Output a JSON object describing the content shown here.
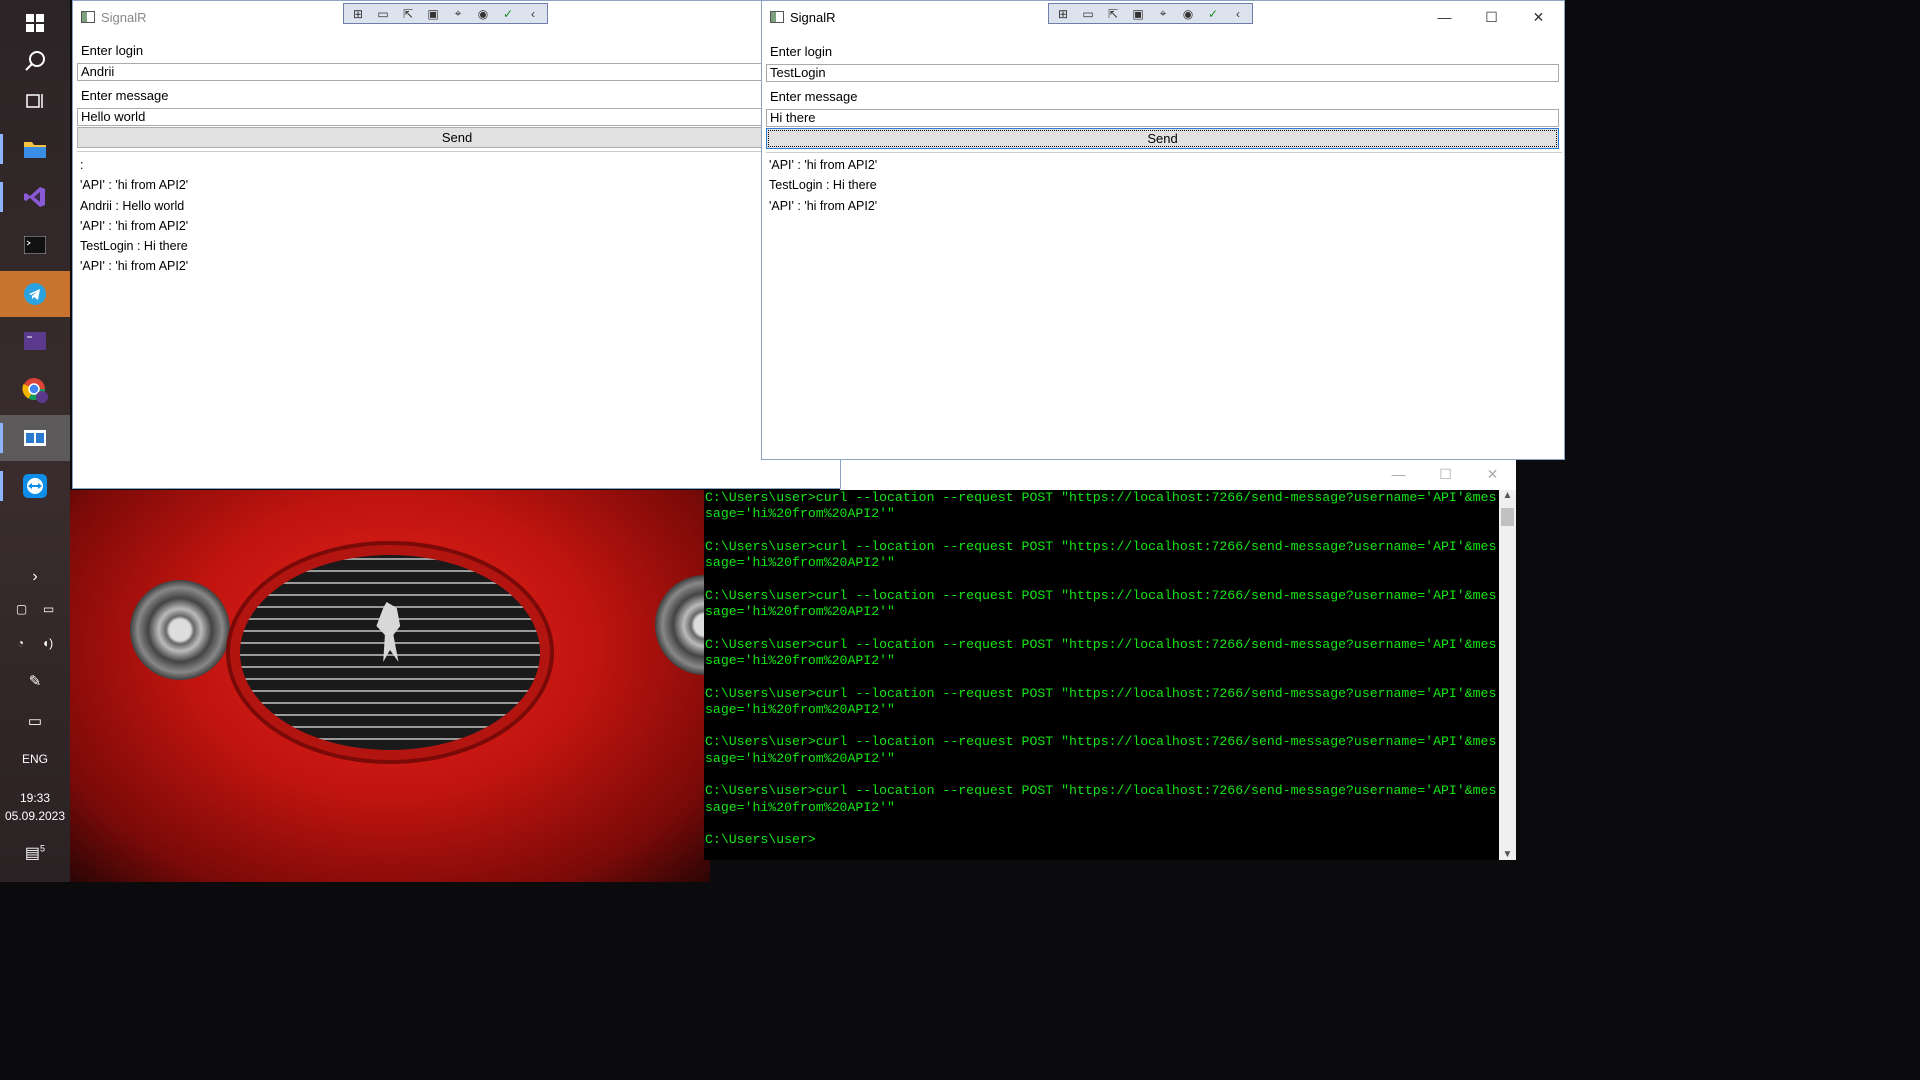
{
  "taskbar": {
    "apps": [
      {
        "name": "start-button",
        "icon": "windows-logo-icon"
      },
      {
        "name": "search-button",
        "icon": "search-icon"
      },
      {
        "name": "task-view-button",
        "icon": "task-view-icon"
      },
      {
        "name": "file-explorer-button",
        "icon": "folder-icon"
      },
      {
        "name": "visual-studio-button",
        "icon": "visual-studio-icon"
      },
      {
        "name": "terminal-button",
        "icon": "terminal-icon"
      },
      {
        "name": "telegram-button",
        "icon": "telegram-icon"
      },
      {
        "name": "dev-prompt-button",
        "icon": "dev-console-icon"
      },
      {
        "name": "chrome-net-button",
        "icon": "chrome-icon"
      },
      {
        "name": "signalr-app-button",
        "icon": "window-app-icon"
      },
      {
        "name": "teamviewer-button",
        "icon": "teamviewer-icon"
      }
    ],
    "language": "ENG",
    "time": "19:33",
    "date": "05.09.2023",
    "notification_count": "5"
  },
  "window_left": {
    "title": "SignalR",
    "login_label": "Enter login",
    "login_value": "Andrii",
    "message_label": "Enter message",
    "message_value": "Hello world",
    "send_label": "Send",
    "messages": [
      ":",
      "'API' : 'hi from API2'",
      "Andrii : Hello world",
      "'API' : 'hi from API2'",
      "TestLogin : Hi there",
      "'API' : 'hi from API2'"
    ]
  },
  "window_right": {
    "title": "SignalR",
    "login_label": "Enter login",
    "login_value": "TestLogin",
    "message_label": "Enter message",
    "message_value": "Hi there",
    "send_label": "Send",
    "messages": [
      "'API' : 'hi from API2'",
      "TestLogin : Hi there",
      "'API' : 'hi from API2'"
    ]
  },
  "console": {
    "text": "C:\\Users\\user>curl --location --request POST \"https://localhost:7266/send-message?username='API'&message='hi%20from%20API2'\"\n\nC:\\Users\\user>curl --location --request POST \"https://localhost:7266/send-message?username='API'&message='hi%20from%20API2'\"\n\nC:\\Users\\user>curl --location --request POST \"https://localhost:7266/send-message?username='API'&message='hi%20from%20API2'\"\n\nC:\\Users\\user>curl --location --request POST \"https://localhost:7266/send-message?username='API'&message='hi%20from%20API2'\"\n\nC:\\Users\\user>curl --location --request POST \"https://localhost:7266/send-message?username='API'&message='hi%20from%20API2'\"\n\nC:\\Users\\user>curl --location --request POST \"https://localhost:7266/send-message?username='API'&message='hi%20from%20API2'\"\n\nC:\\Users\\user>curl --location --request POST \"https://localhost:7266/send-message?username='API'&message='hi%20from%20API2'\"\n\nC:\\Users\\user>",
    "text_color": "#15e615"
  },
  "colors": {
    "accent": "#c8742f",
    "focus": "#2a7bd0"
  }
}
